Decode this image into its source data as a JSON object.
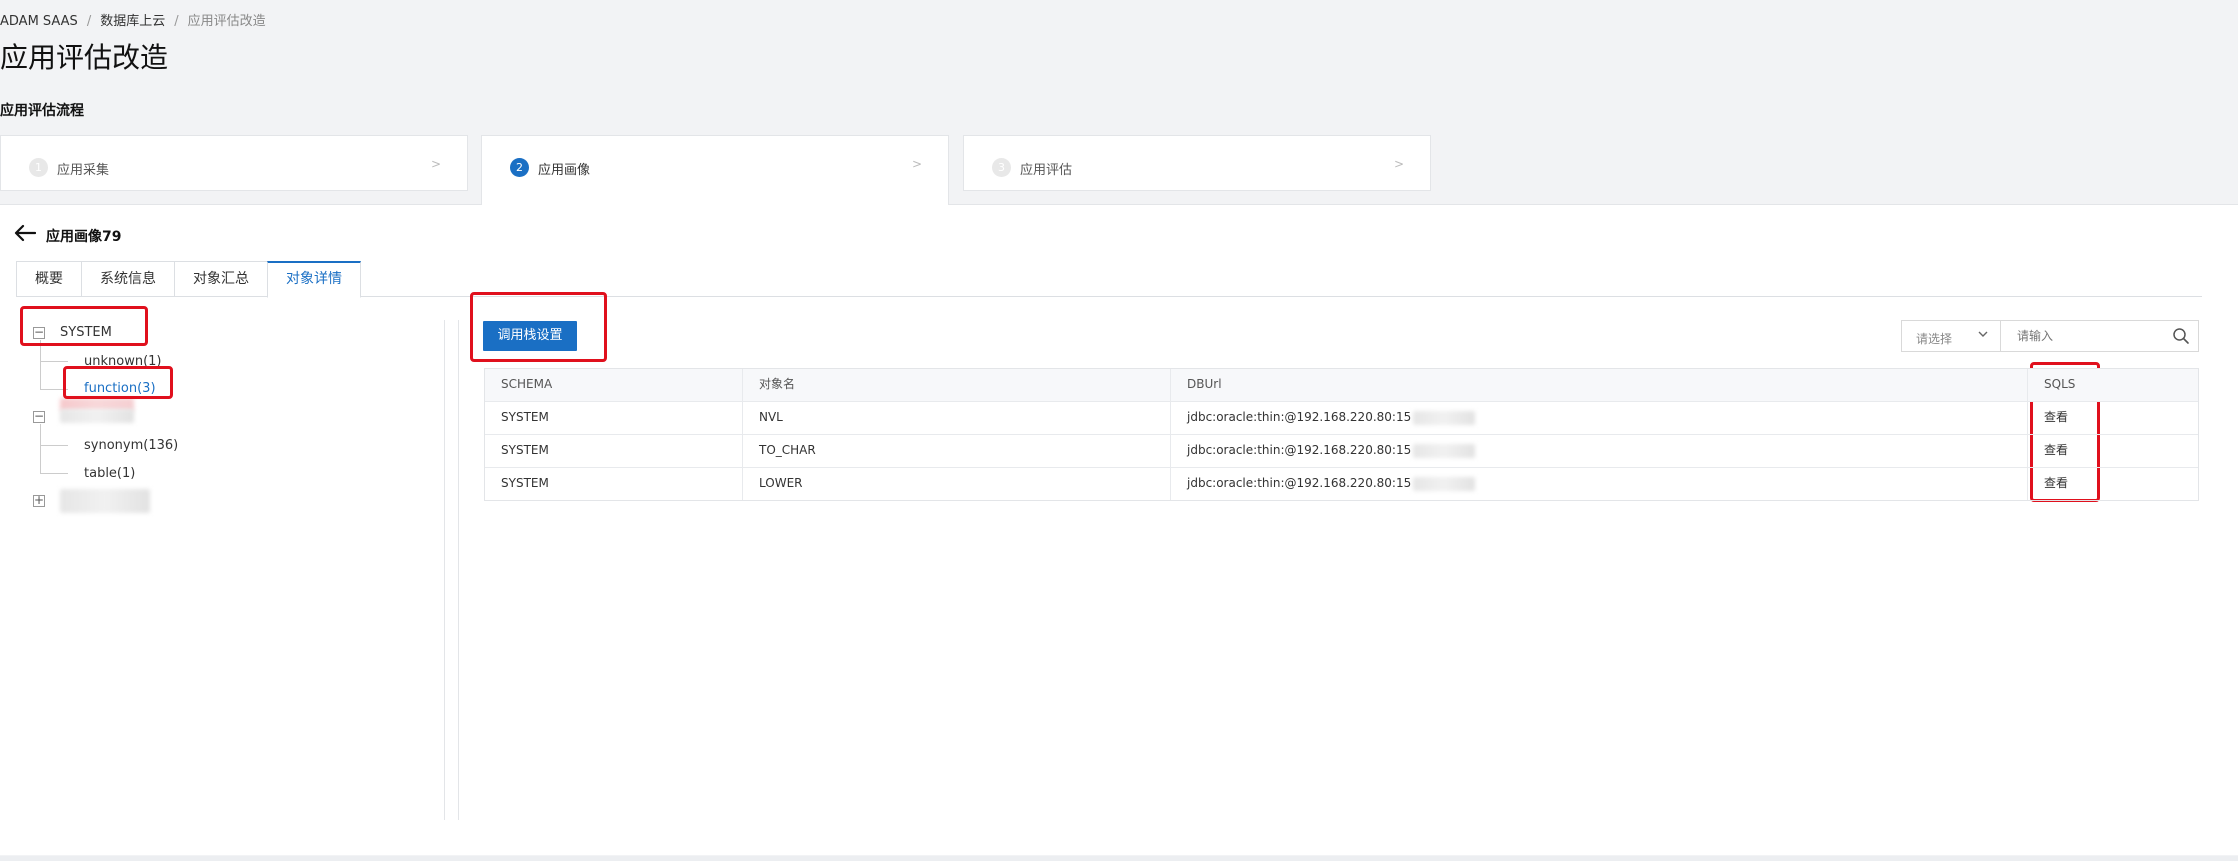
{
  "breadcrumb": {
    "items": [
      "ADAM SAAS",
      "数据库上云"
    ],
    "current": "应用评估改造",
    "separator": "/"
  },
  "page": {
    "title": "应用评估改造",
    "subtitle": "应用评估流程"
  },
  "steps": [
    {
      "num": "1",
      "label": "应用采集",
      "chevron": ">"
    },
    {
      "num": "2",
      "label": "应用画像",
      "chevron": ">"
    },
    {
      "num": "3",
      "label": "应用评估",
      "chevron": ">"
    }
  ],
  "panel": {
    "title": "应用画像79"
  },
  "tabs": [
    "概要",
    "系统信息",
    "对象汇总",
    "对象详情"
  ],
  "active_tab": "对象详情",
  "tree": {
    "root1": "SYSTEM",
    "root1_children": [
      "unknown(1)",
      "function(3)"
    ],
    "root2_children": [
      "synonym(136)",
      "table(1)"
    ],
    "selected": "function(3)"
  },
  "toolbar": {
    "call_stack_button": "调用栈设置",
    "select_placeholder": "请选择",
    "search_placeholder": "请输入"
  },
  "table": {
    "columns": [
      "SCHEMA",
      "对象名",
      "DBUrl",
      "SQLS"
    ],
    "rows": [
      {
        "schema": "SYSTEM",
        "name": "NVL",
        "dburl": "jdbc:oracle:thin:@192.168.220.80:15",
        "sqls": "查看"
      },
      {
        "schema": "SYSTEM",
        "name": "TO_CHAR",
        "dburl": "jdbc:oracle:thin:@192.168.220.80:15",
        "sqls": "查看"
      },
      {
        "schema": "SYSTEM",
        "name": "LOWER",
        "dburl": "jdbc:oracle:thin:@192.168.220.80:15",
        "sqls": "查看"
      }
    ]
  },
  "colors": {
    "primary": "#1a6fc4",
    "highlight_box": "#e0101d"
  }
}
